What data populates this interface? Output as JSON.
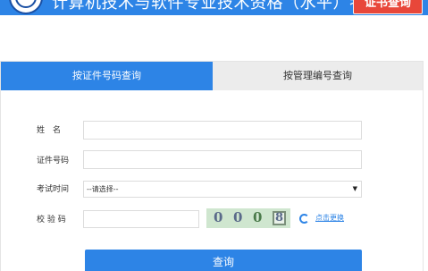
{
  "header": {
    "title": "计算机技术与软件专业技术资格（水平）考试",
    "cert_query_button": "证书查询"
  },
  "tabs": [
    {
      "label": "按证件号码查询",
      "active": true
    },
    {
      "label": "按管理编号查询",
      "active": false
    }
  ],
  "form": {
    "name_label": "姓　名",
    "id_label": "证件号码",
    "time_label": "考试时间",
    "time_selected": "--请选择--",
    "code_label": "校 验 码",
    "captcha_chars": [
      "0",
      "0",
      "0",
      "8"
    ],
    "refresh_link": "点击更换",
    "submit_label": "查询"
  },
  "colors": {
    "primary": "#2d84e6",
    "cert_button": "#e8473a",
    "inactive_tab": "#ececec"
  }
}
